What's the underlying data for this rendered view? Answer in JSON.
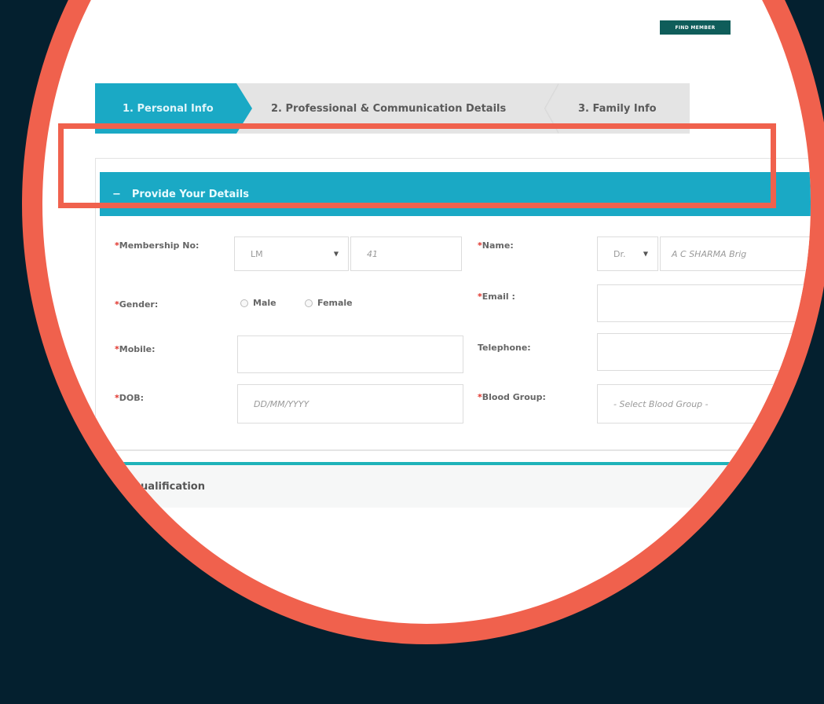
{
  "header": {
    "find_member_label": "FIND MEMBER"
  },
  "steps": [
    {
      "label": "1. Personal Info"
    },
    {
      "label": "2. Professional & Communication Details"
    },
    {
      "label": "3. Family Info"
    }
  ],
  "section": {
    "title": "Provide Your Details",
    "toggle": "−"
  },
  "form": {
    "membership": {
      "label": "Membership No:",
      "prefix_value": "LM",
      "number_value": "41"
    },
    "name": {
      "label": "Name:",
      "title_value": "Dr.",
      "name_value": "A C SHARMA Brig"
    },
    "gender": {
      "label": "Gender:",
      "options": [
        "Male",
        "Female"
      ]
    },
    "email": {
      "label": "Email :",
      "value": ""
    },
    "mobile": {
      "label": "Mobile:",
      "value": ""
    },
    "telephone": {
      "label": "Telephone:",
      "value": ""
    },
    "dob": {
      "label": "DOB:",
      "placeholder": "DD/MM/YYYY"
    },
    "blood_group": {
      "label": "Blood Group:",
      "placeholder": "- Select Blood Group -"
    }
  },
  "qualification": {
    "title": "Qualification"
  },
  "colors": {
    "accent": "#1aa9c5",
    "highlight": "#f0614d",
    "background": "#04202f"
  }
}
